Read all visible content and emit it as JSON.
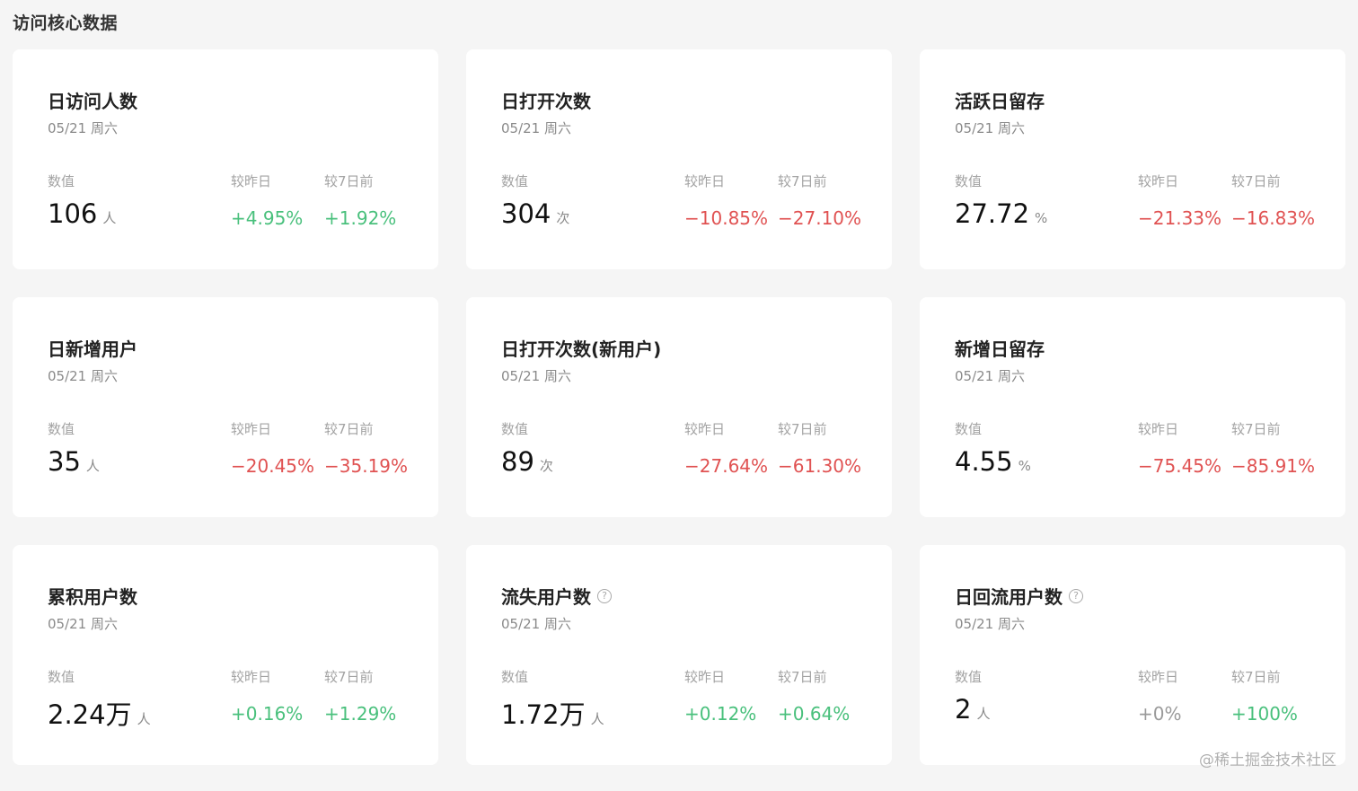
{
  "section_title": "访问核心数据",
  "watermark": "@稀土掘金技术社区",
  "labels": {
    "value": "数值",
    "day_over_day": "较昨日",
    "week_over_week": "较7日前"
  },
  "colors": {
    "up": "#49c07c",
    "down": "#e05252",
    "flat": "#9a9a9a"
  },
  "cards": [
    {
      "title": "日访问人数",
      "date": "05/21 周六",
      "value": "106",
      "unit": "人",
      "dod": "+4.95%",
      "dod_trend": "up",
      "wow": "+1.92%",
      "wow_trend": "up",
      "help": false
    },
    {
      "title": "日打开次数",
      "date": "05/21 周六",
      "value": "304",
      "unit": "次",
      "dod": "−10.85%",
      "dod_trend": "down",
      "wow": "−27.10%",
      "wow_trend": "down",
      "help": false
    },
    {
      "title": "活跃日留存",
      "date": "05/21 周六",
      "value": "27.72",
      "unit": "%",
      "dod": "−21.33%",
      "dod_trend": "down",
      "wow": "−16.83%",
      "wow_trend": "down",
      "help": false
    },
    {
      "title": "日新增用户",
      "date": "05/21 周六",
      "value": "35",
      "unit": "人",
      "dod": "−20.45%",
      "dod_trend": "down",
      "wow": "−35.19%",
      "wow_trend": "down",
      "help": false
    },
    {
      "title": "日打开次数(新用户)",
      "date": "05/21 周六",
      "value": "89",
      "unit": "次",
      "dod": "−27.64%",
      "dod_trend": "down",
      "wow": "−61.30%",
      "wow_trend": "down",
      "help": false
    },
    {
      "title": "新增日留存",
      "date": "05/21 周六",
      "value": "4.55",
      "unit": "%",
      "dod": "−75.45%",
      "dod_trend": "down",
      "wow": "−85.91%",
      "wow_trend": "down",
      "help": false
    },
    {
      "title": "累积用户数",
      "date": "05/21 周六",
      "value": "2.24万",
      "unit": "人",
      "dod": "+0.16%",
      "dod_trend": "up",
      "wow": "+1.29%",
      "wow_trend": "up",
      "help": false
    },
    {
      "title": "流失用户数",
      "date": "05/21 周六",
      "value": "1.72万",
      "unit": "人",
      "dod": "+0.12%",
      "dod_trend": "up",
      "wow": "+0.64%",
      "wow_trend": "up",
      "help": true
    },
    {
      "title": "日回流用户数",
      "date": "05/21 周六",
      "value": "2",
      "unit": "人",
      "dod": "+0%",
      "dod_trend": "flat",
      "wow": "+100%",
      "wow_trend": "up",
      "help": true
    }
  ]
}
